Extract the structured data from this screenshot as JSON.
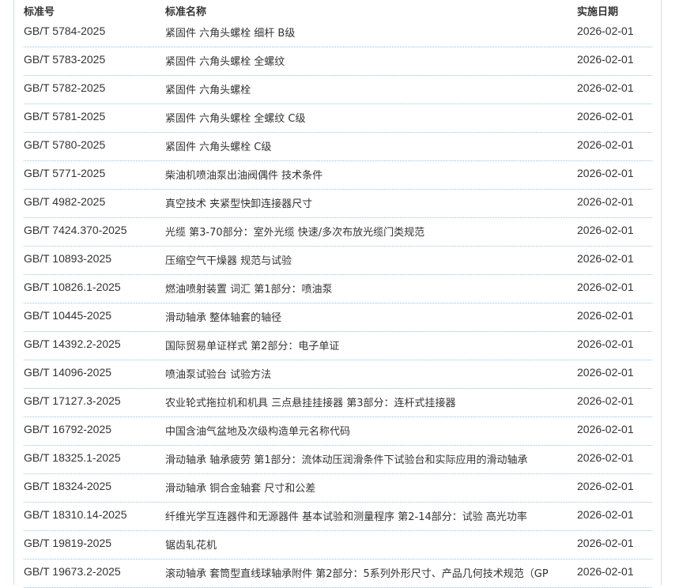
{
  "headers": {
    "code": "标准号",
    "name": "标准名称",
    "date": "实施日期"
  },
  "rows": [
    {
      "code": "GB/T 5784-2025",
      "name": "紧固件 六角头螺栓 细杆 B级",
      "date": "2026-02-01"
    },
    {
      "code": "GB/T 5783-2025",
      "name": "紧固件 六角头螺栓 全螺纹",
      "date": "2026-02-01"
    },
    {
      "code": "GB/T 5782-2025",
      "name": "紧固件 六角头螺栓",
      "date": "2026-02-01"
    },
    {
      "code": "GB/T 5781-2025",
      "name": "紧固件 六角头螺栓 全螺纹 C级",
      "date": "2026-02-01"
    },
    {
      "code": "GB/T 5780-2025",
      "name": "紧固件 六角头螺栓 C级",
      "date": "2026-02-01"
    },
    {
      "code": "GB/T 5771-2025",
      "name": "柴油机喷油泵出油阀偶件 技术条件",
      "date": "2026-02-01"
    },
    {
      "code": "GB/T 4982-2025",
      "name": "真空技术 夹紧型快卸连接器尺寸",
      "date": "2026-02-01"
    },
    {
      "code": "GB/T 7424.370-2025",
      "name": "光缆 第3-70部分：室外光缆 快速/多次布放光缆门类规范",
      "date": "2026-02-01"
    },
    {
      "code": "GB/T 10893-2025",
      "name": "压缩空气干燥器 规范与试验",
      "date": "2026-02-01"
    },
    {
      "code": "GB/T 10826.1-2025",
      "name": "燃油喷射装置 词汇 第1部分：喷油泵",
      "date": "2026-02-01"
    },
    {
      "code": "GB/T 10445-2025",
      "name": "滑动轴承 整体轴套的轴径",
      "date": "2026-02-01"
    },
    {
      "code": "GB/T 14392.2-2025",
      "name": "国际贸易单证样式 第2部分：电子单证",
      "date": "2026-02-01"
    },
    {
      "code": "GB/T 14096-2025",
      "name": "喷油泵试验台 试验方法",
      "date": "2026-02-01"
    },
    {
      "code": "GB/T 17127.3-2025",
      "name": "农业轮式拖拉机和机具 三点悬挂挂接器 第3部分：连杆式挂接器",
      "date": "2026-02-01"
    },
    {
      "code": "GB/T 16792-2025",
      "name": "中国含油气盆地及次级构造单元名称代码",
      "date": "2026-02-01"
    },
    {
      "code": "GB/T 18325.1-2025",
      "name": "滑动轴承 轴承疲劳 第1部分：流体动压润滑条件下试验台和实际应用的滑动轴承",
      "date": "2026-02-01"
    },
    {
      "code": "GB/T 18324-2025",
      "name": "滑动轴承 铜合金轴套 尺寸和公差",
      "date": "2026-02-01"
    },
    {
      "code": "GB/T 18310.14-2025",
      "name": "纤维光学互连器件和无源器件 基本试验和测量程序 第2-14部分：试验 高光功率",
      "date": "2026-02-01"
    },
    {
      "code": "GB/T 19819-2025",
      "name": "锯齿轧花机",
      "date": "2026-02-01"
    },
    {
      "code": "GB/T 19673.2-2025",
      "name": "滚动轴承 套筒型直线球轴承附件 第2部分：5系列外形尺寸、产品几何技术规范（GP",
      "date": "2026-02-01"
    }
  ]
}
